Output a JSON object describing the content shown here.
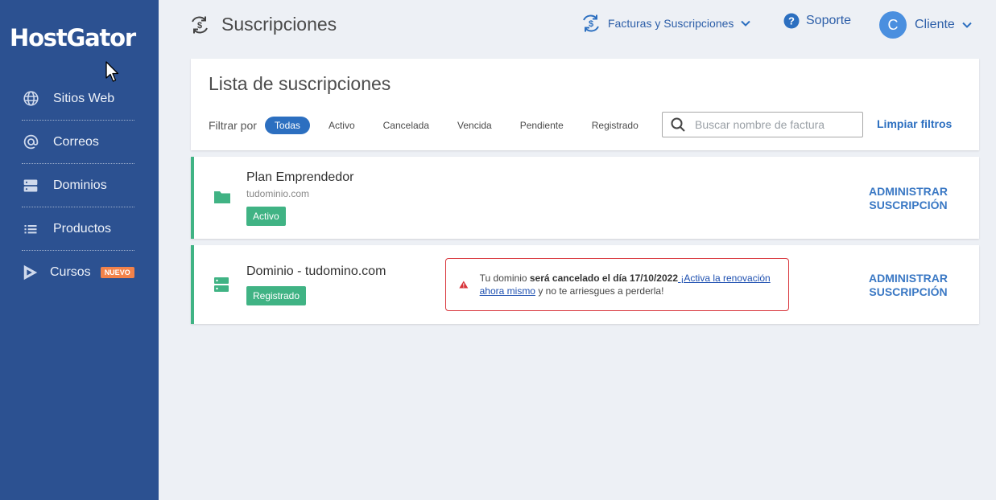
{
  "brand": {
    "logo": "HostGator"
  },
  "sidebar": {
    "items": [
      {
        "label": "Sitios Web",
        "icon": "globe-icon"
      },
      {
        "label": "Correos",
        "icon": "at-icon"
      },
      {
        "label": "Dominios",
        "icon": "server-icon"
      },
      {
        "label": "Productos",
        "icon": "list-icon"
      },
      {
        "label": "Cursos",
        "icon": "play-icon",
        "badge": "NUEVO"
      }
    ]
  },
  "header": {
    "title": "Suscripciones",
    "menu_facturas": "Facturas y Suscripciones",
    "menu_soporte": "Soporte",
    "user_initial": "C",
    "user_name": "Cliente"
  },
  "filters": {
    "title": "Lista de suscripciones",
    "label": "Filtrar por",
    "chips": [
      {
        "label": "Todas",
        "active": true
      },
      {
        "label": "Activo",
        "active": false
      },
      {
        "label": "Cancelada",
        "active": false
      },
      {
        "label": "Vencida",
        "active": false
      },
      {
        "label": "Pendiente",
        "active": false
      },
      {
        "label": "Registrado",
        "active": false
      }
    ],
    "search_placeholder": "Buscar nombre de factura",
    "search_value": "",
    "clear_label": "Limpiar filtros"
  },
  "subscriptions": [
    {
      "name": "Plan Emprendedor",
      "domain": "tudominio.com",
      "status": "Activo",
      "icon": "folder-icon",
      "action_line1": "ADMINISTRAR",
      "action_line2": "SUSCRIPCIÓN"
    },
    {
      "name": "Dominio - tudomino.com",
      "status": "Registrado",
      "icon": "server-icon",
      "action_line1": "ADMINISTRAR",
      "action_line2": "SUSCRIPCIÓN",
      "alert": {
        "prefix": "Tu dominio ",
        "bold": "será cancelado el día  17/10/2022",
        "link": " ¡Activa la renovación ahora mismo",
        "suffix": " y no te arriesgues a perderla!"
      }
    }
  ],
  "colors": {
    "sidebar": "#2c5191",
    "accent": "#2c6fc0",
    "success": "#40b384",
    "alert": "#d8343a"
  }
}
